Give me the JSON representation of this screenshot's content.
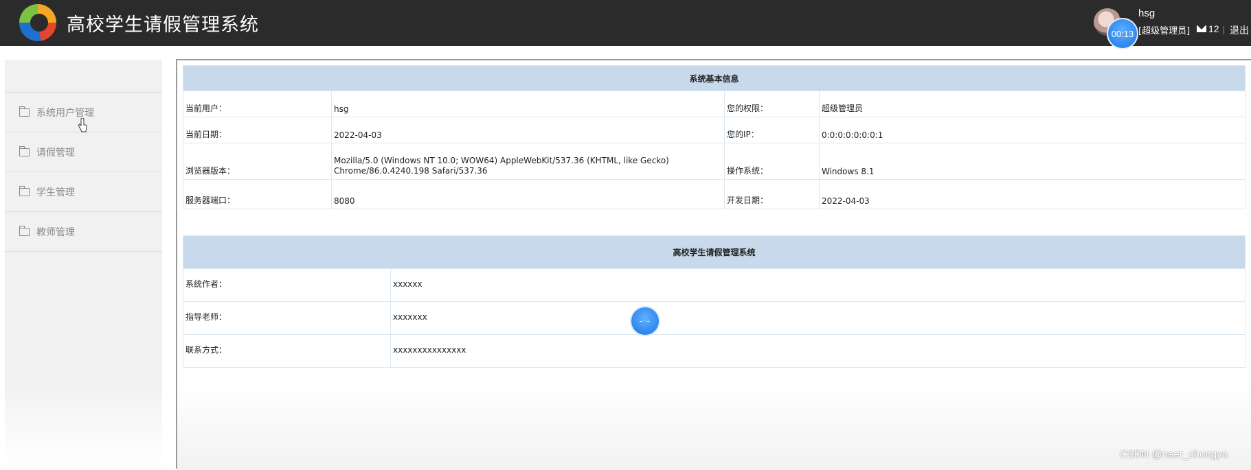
{
  "header": {
    "title": "高校学生请假管理系统",
    "timer": "00:13",
    "user_name": "hsg",
    "user_role": "[超级管理员]",
    "message_count": "12",
    "logout_label": "退出"
  },
  "sidebar": {
    "items": [
      {
        "label": "系统用户管理"
      },
      {
        "label": "请假管理"
      },
      {
        "label": "学生管理"
      },
      {
        "label": "教师管理"
      }
    ]
  },
  "system_info": {
    "heading": "系统基本信息",
    "rows": [
      {
        "label1": "当前用户：",
        "value1": "hsg",
        "label2": "您的权限：",
        "value2": "超级管理员"
      },
      {
        "label1": "当前日期：",
        "value1": "2022-04-03",
        "label2": "您的IP：",
        "value2": "0:0:0:0:0:0:0:1"
      },
      {
        "label1": "浏览器版本：",
        "value1": "Mozilla/5.0 (Windows NT 10.0; WOW64) AppleWebKit/537.36 (KHTML, like Gecko) Chrome/86.0.4240.198 Safari/537.36",
        "label2": "操作系统：",
        "value2": "Windows 8.1"
      },
      {
        "label1": "服务器端口：",
        "value1": "8080",
        "label2": "开发日期：",
        "value2": "2022-04-03"
      }
    ]
  },
  "about": {
    "heading": "高校学生请假管理系统",
    "rows": [
      {
        "label": "系统作者：",
        "value": "xxxxxx"
      },
      {
        "label": "指导老师：",
        "value": "xxxxxxx"
      },
      {
        "label": "联系方式：",
        "value": "xxxxxxxxxxxxxxx"
      }
    ]
  },
  "watermark": "CSDN @naer_chongya",
  "colors": {
    "header_bg": "#2b2b2b",
    "table_heading_bg": "#c7d9ea",
    "accent_blue": "#1b74e4"
  }
}
